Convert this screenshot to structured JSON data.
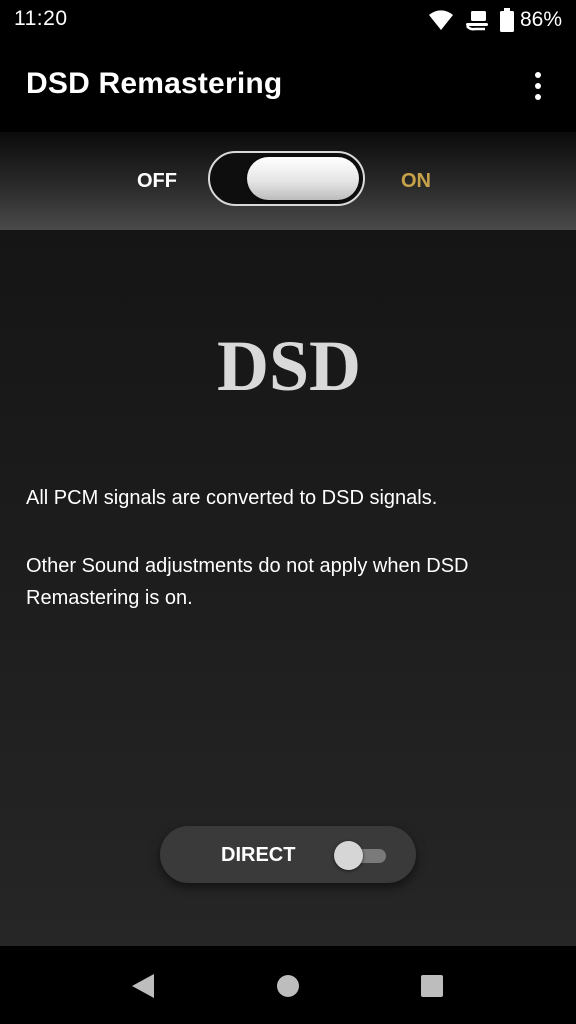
{
  "status_bar": {
    "time": "11:20",
    "battery_percent": "86%",
    "icons": [
      "wifi-icon",
      "notification-icon",
      "battery-icon"
    ]
  },
  "app_bar": {
    "title": "DSD Remastering",
    "menu_icon": "more-vert-icon"
  },
  "main_toggle": {
    "off_label": "OFF",
    "on_label": "ON",
    "state": "on"
  },
  "logo": {
    "text": "DSD"
  },
  "description": {
    "line1": "All PCM signals are converted to DSD signals.",
    "line2": "Other Sound adjustments do not apply when DSD Remastering is on."
  },
  "direct_toggle": {
    "label": "DIRECT",
    "state": "off"
  },
  "nav_bar": {
    "icons": [
      "back-icon",
      "home-icon",
      "recents-icon"
    ]
  },
  "colors": {
    "accent_gold": "#c8a24a",
    "background": "#1b1b1b",
    "text": "#ffffff"
  }
}
